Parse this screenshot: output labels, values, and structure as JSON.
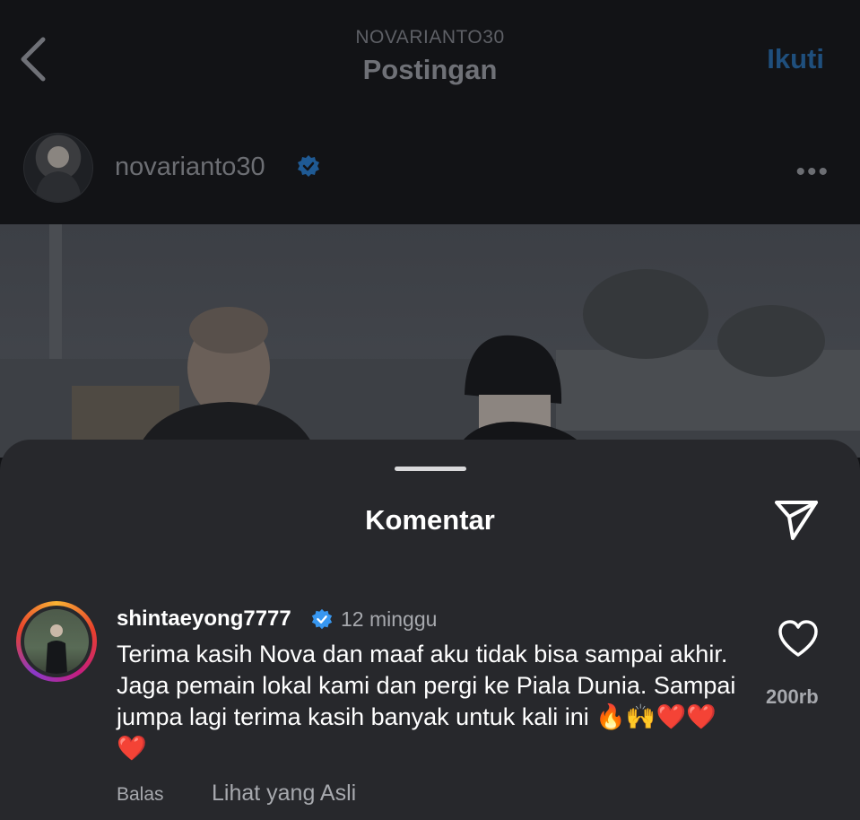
{
  "header": {
    "account": "NOVARIANTO30",
    "title": "Postingan",
    "follow_label": "Ikuti"
  },
  "post": {
    "username": "novarianto30",
    "more_label": "•••"
  },
  "comments_sheet": {
    "title": "Komentar",
    "comment": {
      "username": "shintaeyong7777",
      "time": "12 minggu",
      "text": "Terima kasih Nova dan maaf aku tidak bisa sampai akhir. Jaga pemain lokal kami dan pergi ke Piala Dunia. Sampai jumpa lagi terima kasih banyak untuk kali ini 🔥🙌❤️❤️❤️",
      "like_count": "200rb",
      "reply_label": "Balas",
      "see_original_label": "Lihat yang Asli"
    }
  },
  "colors": {
    "background": "#121316",
    "sheet": "#27282c",
    "follow_accent": "#1f4f7d",
    "verified": "#3897f0"
  },
  "icons": [
    "back-chevron-icon",
    "verified-badge-icon",
    "more-options-icon",
    "send-share-icon",
    "heart-icon"
  ]
}
